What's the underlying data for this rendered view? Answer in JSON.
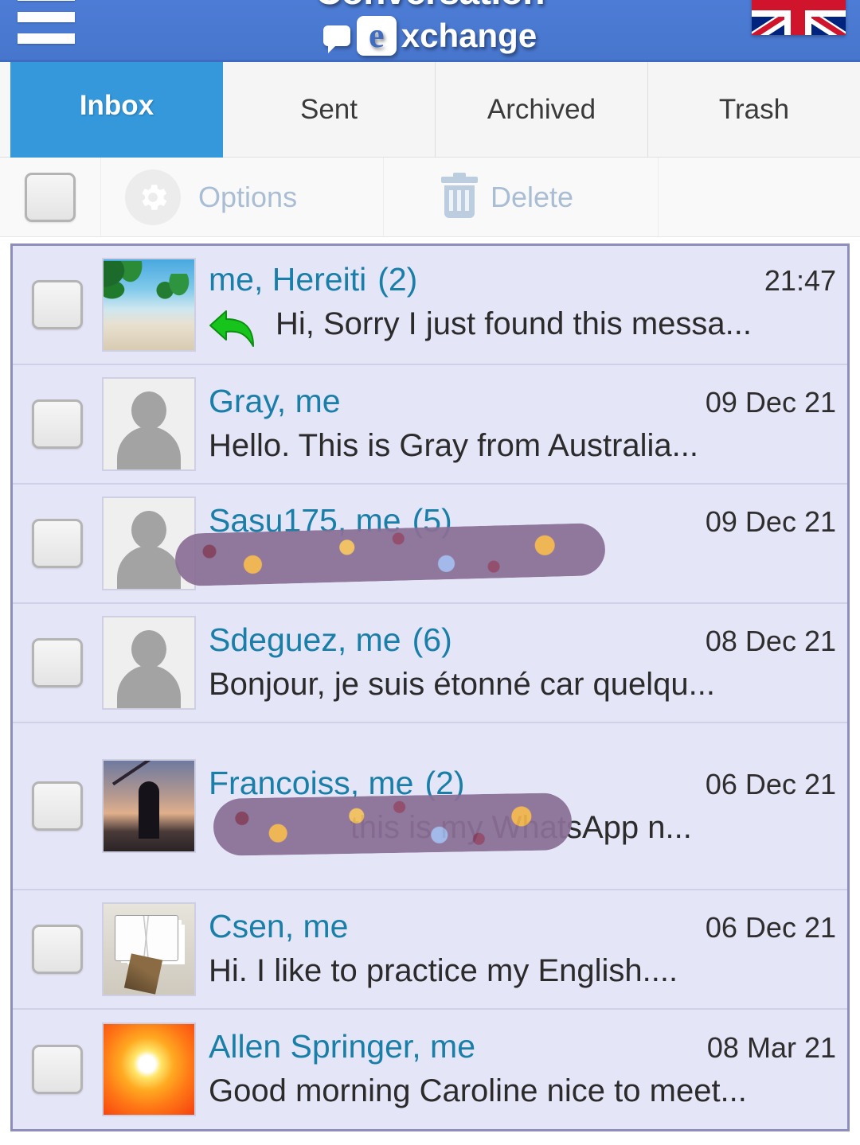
{
  "header": {
    "logo_line1": "Conversation",
    "logo_line2": "xchange",
    "logo_e": "e",
    "menu_icon": "hamburger-menu-icon",
    "flag_label": "United Kingdom",
    "bg_color": "#4d7cd6"
  },
  "tabs": [
    {
      "label": "Inbox",
      "active": true
    },
    {
      "label": "Sent",
      "active": false
    },
    {
      "label": "Archived",
      "active": false
    },
    {
      "label": "Trash",
      "active": false
    }
  ],
  "toolbar": {
    "select_all_checked": false,
    "options_label": "Options",
    "delete_label": "Delete"
  },
  "messages": [
    {
      "sender": "me, Hereiti",
      "count": "(2)",
      "date": "21:47",
      "preview": "Hi, Sorry I just found this messa...",
      "thumb": "beach-photo",
      "replied": true,
      "redacted": false,
      "two_line": false
    },
    {
      "sender": "Gray, me",
      "count": "",
      "date": "09 Dec 21",
      "preview": "Hello. This is Gray from Australia...",
      "thumb": "default-avatar",
      "replied": false,
      "redacted": false,
      "two_line": false
    },
    {
      "sender": "Sasu175, me",
      "count": "(5)",
      "date": "09 Dec 21",
      "preview": "                     ",
      "thumb": "default-avatar",
      "replied": false,
      "redacted": true,
      "two_line": false
    },
    {
      "sender": "Sdeguez, me",
      "count": "(6)",
      "date": "08 Dec 21",
      "preview": "Bonjour, je suis étonné car quelqu...",
      "thumb": "default-avatar",
      "replied": false,
      "redacted": false,
      "two_line": false
    },
    {
      "sender": "Francoiss, me",
      "count": "(2)",
      "date": "06 Dec 21",
      "preview": "                this is my WhatsApp n...",
      "thumb": "fishing-photo",
      "replied": false,
      "redacted": true,
      "two_line": true
    },
    {
      "sender": "Csen, me",
      "count": "",
      "date": "06 Dec 21",
      "preview": "Hi. I like to practice my English....",
      "thumb": "playing-cards-photo",
      "replied": false,
      "redacted": false,
      "two_line": false
    },
    {
      "sender": "Allen Springer, me",
      "count": "",
      "date": "08 Mar 21",
      "preview": "Good morning Caroline nice to meet...",
      "thumb": "sunset-photo",
      "replied": false,
      "redacted": false,
      "two_line": false
    }
  ],
  "colors": {
    "header_blue": "#4d7cd6",
    "tab_active": "#3498db",
    "sender_link": "#1a7fa8",
    "row_bg": "#e5e5f8",
    "list_border": "#8e8ebd",
    "toolbar_label": "#a9bdd4",
    "redaction": "#8a6f96"
  }
}
